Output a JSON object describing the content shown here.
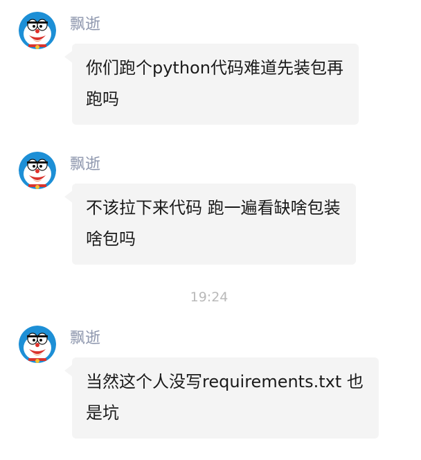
{
  "messages": [
    {
      "sender": "飘逝",
      "lines": [
        "你们跑个python代码难道先装包再",
        "跑吗"
      ]
    },
    {
      "sender": "飘逝",
      "lines": [
        "不该拉下来代码 跑一遍看缺啥包装",
        "啥包吗"
      ]
    },
    {
      "sender": "飘逝",
      "lines": [
        "当然这个人没写requirements.txt 也",
        "是坑"
      ]
    }
  ],
  "timestamp": "19:24",
  "icons": {
    "avatar": "doraemon-avatar-icon"
  },
  "colors": {
    "sender_name": "#8d96ad",
    "bubble_bg": "#f4f4f4",
    "timestamp": "#b9b9b9"
  }
}
